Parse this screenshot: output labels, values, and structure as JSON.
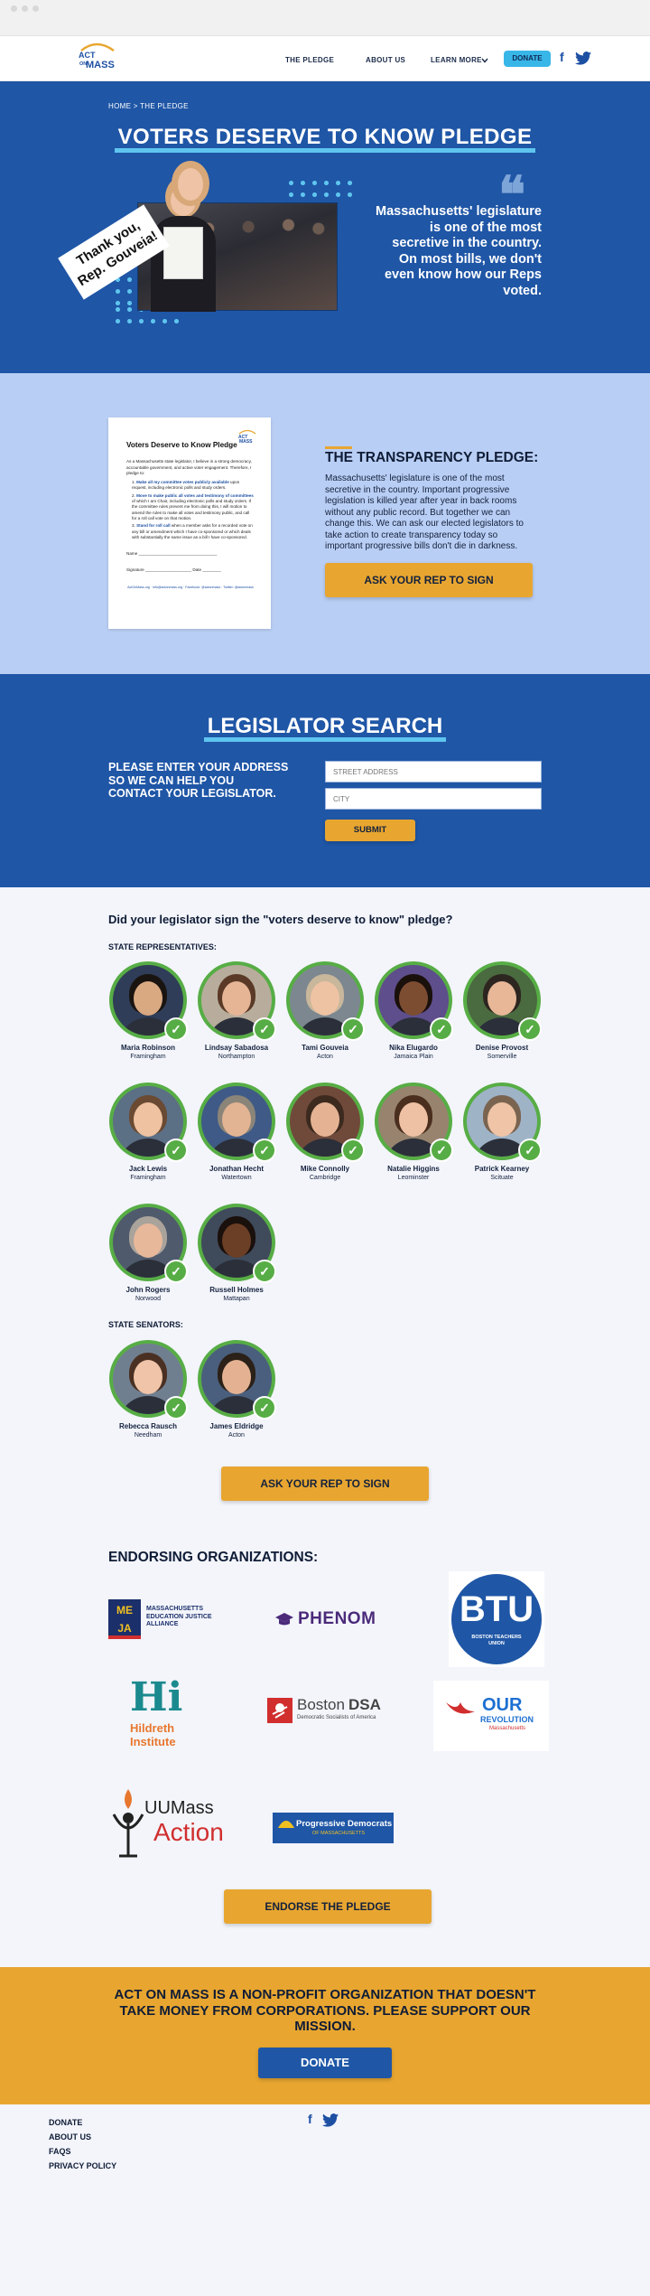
{
  "nav": {
    "logo_line1": "ACT",
    "logo_line2": "ON",
    "logo_line3": "MASS",
    "links": [
      "THE PLEDGE",
      "ABOUT US",
      "LEARN MORE"
    ],
    "donate_label": "DONATE",
    "social_icons": [
      "facebook-icon",
      "twitter-icon"
    ]
  },
  "hero": {
    "breadcrumb": "HOME > THE PLEDGE",
    "title": "VOTERS DESERVE TO KNOW PLEDGE",
    "thanks_sign": "Thank you, Rep. Gouveia!",
    "quote_mark": "❝",
    "quote": "Massachusetts' legislature is one of the most secretive in the country.  On most bills, we don't even know how our Reps voted."
  },
  "pledge": {
    "doc_title": "Voters Deserve to Know Pledge",
    "doc_intro": "As a Massachusetts state legislator, I believe in a strong democracy, accountable government, and active voter engagement. Therefore, I pledge to:",
    "doc_items": [
      {
        "lead": "Make all my committee votes publicly available",
        "rest": " upon request, including electronic polls and study orders."
      },
      {
        "lead": "Move to make public all votes and testimony of committees",
        "rest": " of which I am Chair, including electronic polls and study orders. If the committee rules prevent me from doing this, I will motion to amend the rules to make all votes and testimony public, and call for a roll call vote on that motion."
      },
      {
        "lead": "Stand for roll call",
        "rest": " when a member asks for a recorded vote on any bill or amendment which I have co-sponsored or which deals with substantially the same issue as a bill I have co-sponsored."
      }
    ],
    "doc_name_label": "Name",
    "doc_signature_label": "Signature",
    "doc_date_label": "Date",
    "doc_footer": "ActOnMass.org · info@actonmass.org · Facebook: @actonmass · Twitter: @actonmass",
    "heading": "THE TRANSPARENCY PLEDGE:",
    "body": "Massachusetts' legislature is one of the most secretive in the country. Important progressive legislation is killed year after year in back rooms without any public record. But together we can change this. We can ask our elected legislators to take action to create transparency today so important progressive bills don't die in darkness.",
    "button": "ASK YOUR REP TO SIGN"
  },
  "search": {
    "title": "LEGISLATOR SEARCH",
    "prompt": "PLEASE ENTER YOUR ADDRESS SO WE CAN HELP YOU CONTACT YOUR LEGISLATOR.",
    "street_placeholder": "STREET ADDRESS",
    "city_placeholder": "CITY",
    "submit": "SUBMIT"
  },
  "signers": {
    "question": "Did your legislator sign the \"voters deserve to know\" pledge?",
    "reps_label": "STATE REPRESENTATIVES:",
    "senators_label": "STATE SENATORS:",
    "check_glyph": "✓",
    "reps": [
      {
        "name": "Maria Robinson",
        "town": "Framingham",
        "skin": "#d9a981",
        "hair": "#1a1411",
        "bg": "#2f3d58"
      },
      {
        "name": "Lindsay Sabadosa",
        "town": "Northampton",
        "skin": "#e6b596",
        "hair": "#5a3a27",
        "bg": "#b8ad9c"
      },
      {
        "name": "Tami Gouveia",
        "town": "Acton",
        "skin": "#eec3a4",
        "hair": "#c9b79b",
        "bg": "#7c8790"
      },
      {
        "name": "Nika Elugardo",
        "town": "Jamaica Plain",
        "skin": "#7d4d32",
        "hair": "#1a100c",
        "bg": "#5e4e8b"
      },
      {
        "name": "Denise Provost",
        "town": "Somerville",
        "skin": "#e7b798",
        "hair": "#2d2520",
        "bg": "#4a6a3f"
      },
      {
        "name": "Jack Lewis",
        "town": "Framingham",
        "skin": "#efc2a2",
        "hair": "#6a4a32",
        "bg": "#5b6f85"
      },
      {
        "name": "Jonathan Hecht",
        "town": "Watertown",
        "skin": "#e2b493",
        "hair": "#8a8479",
        "bg": "#3f5a86"
      },
      {
        "name": "Mike Connolly",
        "town": "Cambridge",
        "skin": "#e5b394",
        "hair": "#3d2a1e",
        "bg": "#6f4a3a"
      },
      {
        "name": "Natalie Higgins",
        "town": "Leominster",
        "skin": "#eec1a4",
        "hair": "#4a2e1e",
        "bg": "#97836e"
      },
      {
        "name": "Patrick Kearney",
        "town": "Scituate",
        "skin": "#f0c4a6",
        "hair": "#7a6450",
        "bg": "#9fb3c7"
      },
      {
        "name": "John Rogers",
        "town": "Norwood",
        "skin": "#e8b89b",
        "hair": "#a9a39b",
        "bg": "#4f5a6c"
      },
      {
        "name": "Russell Holmes",
        "town": "Mattapan",
        "skin": "#6b3e26",
        "hair": "#1a100c",
        "bg": "#3f4a5b"
      }
    ],
    "senators": [
      {
        "name": "Rebecca Rausch",
        "town": "Needham",
        "skin": "#efc4a8",
        "hair": "#4a3022",
        "bg": "#707f90"
      },
      {
        "name": "James Eldridge",
        "town": "Acton",
        "skin": "#e4b292",
        "hair": "#2b2118",
        "bg": "#4a5f7d"
      }
    ],
    "button": "ASK YOUR REP TO SIGN"
  },
  "orgs": {
    "title": "ENDORSING ORGANIZATIONS:",
    "meja_mark": "ME JA",
    "meja_text": "MASSACHUSETTS EDUCATION JUSTICE ALLIANCE",
    "phenom": "PHENOM",
    "btu_mark": "BTU",
    "btu_text": "BOSTON TEACHERS UNION",
    "hildreth_mark": "Hi",
    "hildreth_text": "Hildreth Institute",
    "dsa_word1": "Boston",
    "dsa_word2": "DSA",
    "dsa_sub": "Democratic Socialists of America",
    "our_line1": "OUR",
    "our_line2": "REVOLUTION",
    "our_line3": "Massachusetts",
    "uumass_line1": "UUMass",
    "uumass_line2": "Action",
    "pdm_text": "Progressive Democrats",
    "pdm_sub": "OF MASSACHUSETTS",
    "button": "ENDORSE THE PLEDGE"
  },
  "cta": {
    "text": "ACT ON MASS IS A NON-PROFIT ORGANIZATION THAT DOESN'T TAKE MONEY FROM CORPORATIONS. PLEASE SUPPORT OUR MISSION.",
    "button": "DONATE"
  },
  "footer": {
    "links": [
      "DONATE",
      "ABOUT US",
      "FAQS",
      "PRIVACY POLICY"
    ]
  }
}
